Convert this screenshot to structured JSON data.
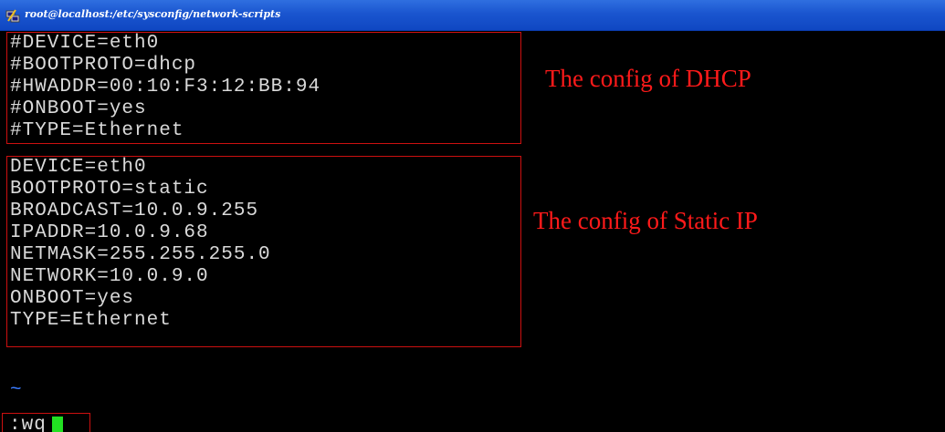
{
  "window": {
    "title": "root@localhost:/etc/sysconfig/network-scripts",
    "icon": "putty-terminal-icon"
  },
  "dhcp_block": {
    "lines": [
      "#DEVICE=eth0",
      "#BOOTPROTO=dhcp",
      "#HWADDR=00:10:F3:12:BB:94",
      "#ONBOOT=yes",
      "#TYPE=Ethernet"
    ],
    "annotation": "The config of DHCP"
  },
  "static_block": {
    "lines": [
      "DEVICE=eth0",
      "BOOTPROTO=static",
      "BROADCAST=10.0.9.255",
      "IPADDR=10.0.9.68",
      "NETMASK=255.255.255.0",
      "NETWORK=10.0.9.0",
      "ONBOOT=yes",
      "TYPE=Ethernet"
    ],
    "annotation": "The config of Static IP"
  },
  "editor": {
    "tilde": "~",
    "command": ":wq"
  },
  "colors": {
    "background": "#000000",
    "text": "#d9d9d9",
    "annotation": "#ff1a1a",
    "box_border": "#cc1010",
    "cursor": "#22e022",
    "tilde": "#3a7bff",
    "titlebar": "#1a55cf"
  }
}
